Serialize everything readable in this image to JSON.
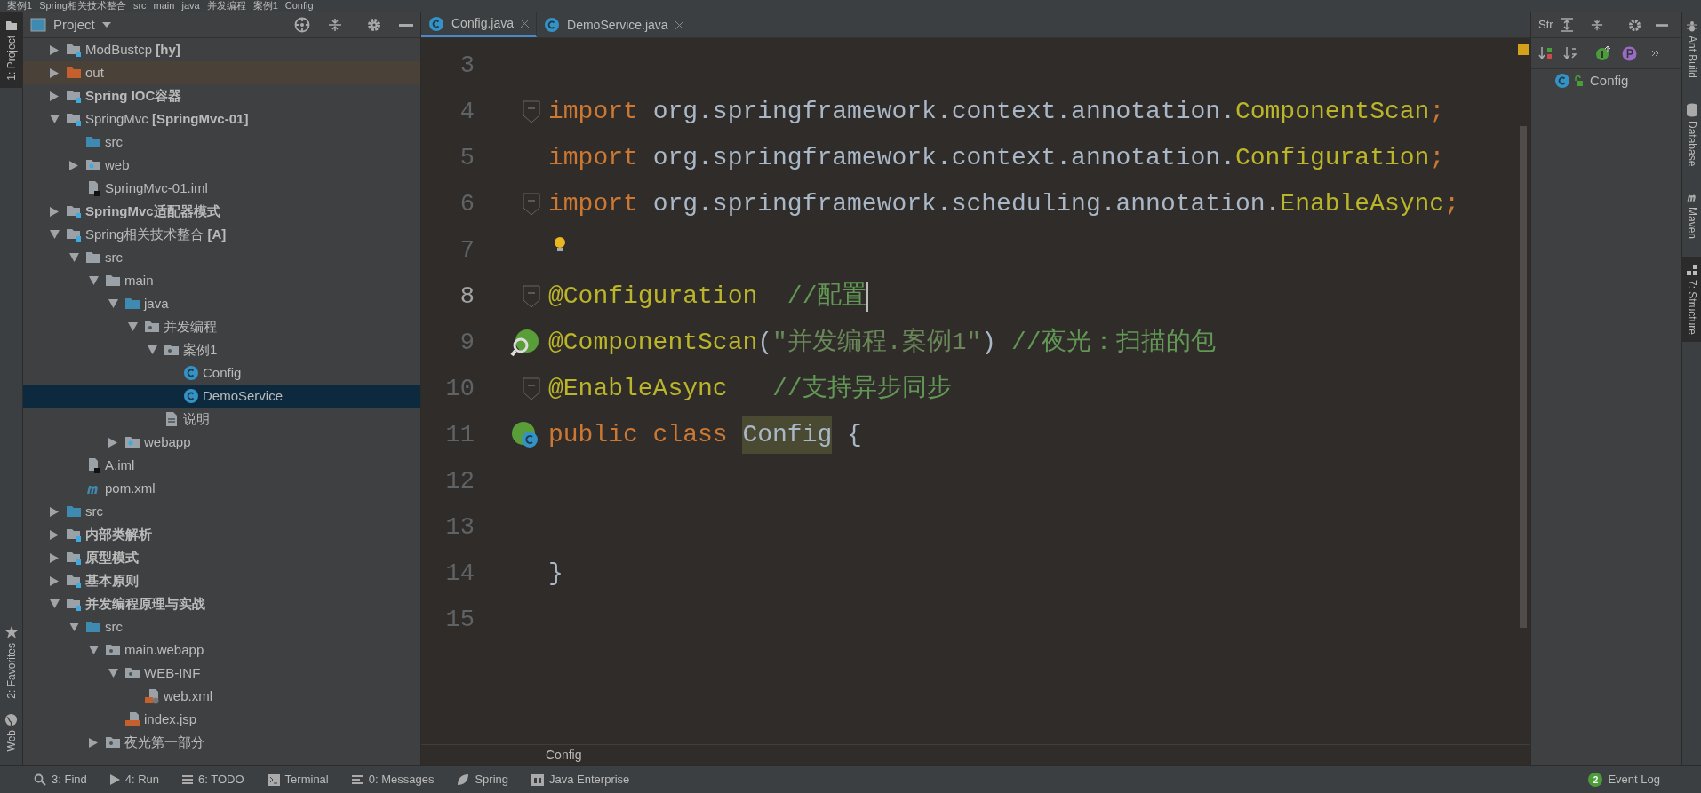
{
  "breadcrumb": [
    "案例1",
    "Spring相关技术整合",
    "src",
    "main",
    "java",
    "并发编程",
    "案例1",
    "Config"
  ],
  "left_stripe": [
    {
      "label": "1: Project",
      "selected": true,
      "kind": "folder"
    },
    {
      "label": "2: Favorites",
      "selected": false,
      "kind": "star"
    },
    {
      "label": "Web",
      "selected": false,
      "kind": "globe"
    }
  ],
  "project_panel": {
    "title": "Project",
    "tree": [
      {
        "label": "ModBustcp **[hy]**",
        "kind": "module",
        "bold": false,
        "expanded": false,
        "selected": false,
        "excluded": false
      },
      {
        "label": "out",
        "kind": "excluded_folder",
        "bold": false,
        "expanded": false,
        "selected": false,
        "excluded": true
      },
      {
        "label": "Spring IOC容器",
        "kind": "module",
        "bold": true,
        "expanded": false,
        "selected": false,
        "excluded": false
      },
      {
        "label": "SpringMvc **[SpringMvc-01]**",
        "kind": "module",
        "bold": false,
        "expanded": true,
        "selected": false,
        "excluded": false,
        "children": [
          {
            "label": "src",
            "kind": "source_folder",
            "bold": false,
            "selected": false,
            "excluded": false
          },
          {
            "label": "web",
            "kind": "web_folder",
            "bold": false,
            "expanded": false,
            "selected": false,
            "excluded": false
          },
          {
            "label": "SpringMvc-01.iml",
            "kind": "iml",
            "bold": false,
            "selected": false,
            "excluded": false
          }
        ]
      },
      {
        "label": "SpringMvc适配器模式",
        "kind": "module",
        "bold": true,
        "expanded": false,
        "selected": false,
        "excluded": false
      },
      {
        "label": "Spring相关技术整合 **[A]**",
        "kind": "module",
        "bold": false,
        "expanded": true,
        "selected": false,
        "excluded": false,
        "children": [
          {
            "label": "src",
            "kind": "folder",
            "bold": false,
            "expanded": true,
            "selected": false,
            "excluded": false,
            "children": [
              {
                "label": "main",
                "kind": "folder",
                "bold": false,
                "expanded": true,
                "selected": false,
                "excluded": false,
                "children": [
                  {
                    "label": "java",
                    "kind": "source_folder",
                    "bold": false,
                    "expanded": true,
                    "selected": false,
                    "excluded": false,
                    "children": [
                      {
                        "label": "并发编程",
                        "kind": "package",
                        "bold": false,
                        "expanded": true,
                        "selected": false,
                        "excluded": false,
                        "children": [
                          {
                            "label": "案例1",
                            "kind": "package",
                            "bold": false,
                            "expanded": true,
                            "selected": false,
                            "excluded": false,
                            "children": [
                              {
                                "label": "Config",
                                "kind": "class",
                                "bold": false,
                                "selected": false,
                                "excluded": false
                              },
                              {
                                "label": "DemoService",
                                "kind": "class",
                                "bold": false,
                                "selected": true,
                                "excluded": false
                              }
                            ]
                          },
                          {
                            "label": "说明",
                            "kind": "text",
                            "bold": false,
                            "selected": false,
                            "excluded": false
                          }
                        ]
                      }
                    ]
                  },
                  {
                    "label": "webapp",
                    "kind": "web_folder",
                    "bold": false,
                    "expanded": false,
                    "selected": false,
                    "excluded": false
                  }
                ]
              }
            ]
          },
          {
            "label": "A.iml",
            "kind": "iml",
            "bold": false,
            "selected": false,
            "excluded": false
          },
          {
            "label": "pom.xml",
            "kind": "maven",
            "bold": false,
            "selected": false,
            "excluded": false
          }
        ]
      },
      {
        "label": "src",
        "kind": "source_folder",
        "bold": false,
        "expanded": false,
        "selected": false,
        "excluded": false
      },
      {
        "label": "内部类解析",
        "kind": "module",
        "bold": true,
        "expanded": false,
        "selected": false,
        "excluded": false
      },
      {
        "label": "原型模式",
        "kind": "module",
        "bold": true,
        "expanded": false,
        "selected": false,
        "excluded": false
      },
      {
        "label": "基本原则",
        "kind": "module",
        "bold": true,
        "expanded": false,
        "selected": false,
        "excluded": false
      },
      {
        "label": "并发编程原理与实战",
        "kind": "module",
        "bold": true,
        "expanded": true,
        "selected": false,
        "excluded": false,
        "children": [
          {
            "label": "src",
            "kind": "source_folder",
            "bold": false,
            "expanded": true,
            "selected": false,
            "excluded": false,
            "children": [
              {
                "label": "main.webapp",
                "kind": "package",
                "bold": false,
                "expanded": true,
                "selected": false,
                "excluded": false,
                "children": [
                  {
                    "label": "WEB-INF",
                    "kind": "package",
                    "bold": false,
                    "expanded": true,
                    "selected": false,
                    "excluded": false,
                    "children": [
                      {
                        "label": "web.xml",
                        "kind": "xml",
                        "bold": false,
                        "selected": false,
                        "excluded": false
                      }
                    ]
                  },
                  {
                    "label": "index.jsp",
                    "kind": "jsp",
                    "bold": false,
                    "selected": false,
                    "excluded": false
                  }
                ]
              },
              {
                "label": "夜光第一部分",
                "kind": "package",
                "bold": false,
                "expanded": false,
                "selected": false,
                "excluded": false
              }
            ]
          }
        ]
      }
    ]
  },
  "editor": {
    "tabs": [
      {
        "label": "Config.java",
        "selected": true
      },
      {
        "label": "DemoService.java",
        "selected": false
      }
    ],
    "lines": [
      {
        "number": "3",
        "kind": "plain",
        "caret": false
      },
      {
        "number": "4",
        "kind": "fold",
        "caret": false,
        "tokens": [
          {
            "kind": "keyword",
            "text": "import "
          },
          {
            "kind": "plain",
            "text": "org.springframework.context.annotation."
          },
          {
            "kind": "annotation",
            "text": "ComponentScan"
          },
          {
            "kind": "keyword",
            "text": ";"
          }
        ]
      },
      {
        "number": "5",
        "kind": "plain",
        "caret": false,
        "tokens": [
          {
            "kind": "keyword",
            "text": "import "
          },
          {
            "kind": "plain",
            "text": "org.springframework.context.annotation."
          },
          {
            "kind": "annotation",
            "text": "Configuration"
          },
          {
            "kind": "keyword",
            "text": ";"
          }
        ]
      },
      {
        "number": "6",
        "kind": "fold",
        "caret": false,
        "tokens": [
          {
            "kind": "keyword",
            "text": "import "
          },
          {
            "kind": "plain",
            "text": "org.springframework.scheduling.annotation."
          },
          {
            "kind": "annotation",
            "text": "EnableAsync"
          },
          {
            "kind": "keyword",
            "text": ";"
          }
        ]
      },
      {
        "number": "7",
        "kind": "bulb",
        "caret": false
      },
      {
        "number": "8",
        "kind": "fold",
        "caret": true,
        "tokens": [
          {
            "kind": "annotation",
            "text": "@Configuration"
          },
          {
            "kind": "comment",
            "text": "  //配置"
          }
        ]
      },
      {
        "number": "9",
        "kind": "bean_scan",
        "caret": false,
        "tokens": [
          {
            "kind": "annotation",
            "text": "@ComponentScan"
          },
          {
            "kind": "plain",
            "text": "("
          },
          {
            "kind": "string",
            "text": "\"并发编程.案例1\""
          },
          {
            "kind": "plain",
            "text": ")"
          },
          {
            "kind": "comment",
            "text": " //夜光：扫描的包"
          }
        ]
      },
      {
        "number": "10",
        "kind": "fold",
        "caret": false,
        "tokens": [
          {
            "kind": "annotation",
            "text": "@EnableAsync"
          },
          {
            "kind": "comment",
            "text": "   //支持异步同步"
          }
        ]
      },
      {
        "number": "11",
        "kind": "bean_class",
        "caret": false,
        "tokens": [
          {
            "kind": "keyword",
            "text": "public class "
          },
          {
            "kind": "highlight",
            "text": "Config"
          },
          {
            "kind": "plain",
            "text": " {"
          }
        ]
      },
      {
        "number": "12",
        "kind": "plain",
        "caret": false
      },
      {
        "number": "13",
        "kind": "plain",
        "caret": false
      },
      {
        "number": "14",
        "kind": "plain",
        "caret": false,
        "tokens": [
          {
            "kind": "plain",
            "text": "}"
          }
        ]
      },
      {
        "number": "15",
        "kind": "plain",
        "caret": false
      }
    ],
    "footer": "Config"
  },
  "structure_panel": {
    "title": "Str",
    "items": [
      {
        "label": "Config",
        "kind": "class"
      }
    ]
  },
  "right_stripe": [
    {
      "label": "Ant Build",
      "selected": false,
      "kind": "ant"
    },
    {
      "label": "Database",
      "selected": false,
      "kind": "database"
    },
    {
      "label": "Maven",
      "selected": false,
      "kind": "maven"
    },
    {
      "label": "7: Structure",
      "selected": true,
      "kind": "structure"
    }
  ],
  "bottom_toolbar": [
    {
      "label": "3: Find",
      "kind": "search"
    },
    {
      "label": "4: Run",
      "kind": "run"
    },
    {
      "label": "6: TODO",
      "kind": "list"
    },
    {
      "label": "Terminal",
      "kind": "terminal"
    },
    {
      "label": "0: Messages",
      "kind": "messages"
    },
    {
      "label": "Spring",
      "kind": "leaf"
    },
    {
      "label": "Java Enterprise",
      "kind": "enterprise"
    }
  ],
  "event_log": {
    "label": "Event Log",
    "badge": "2"
  }
}
